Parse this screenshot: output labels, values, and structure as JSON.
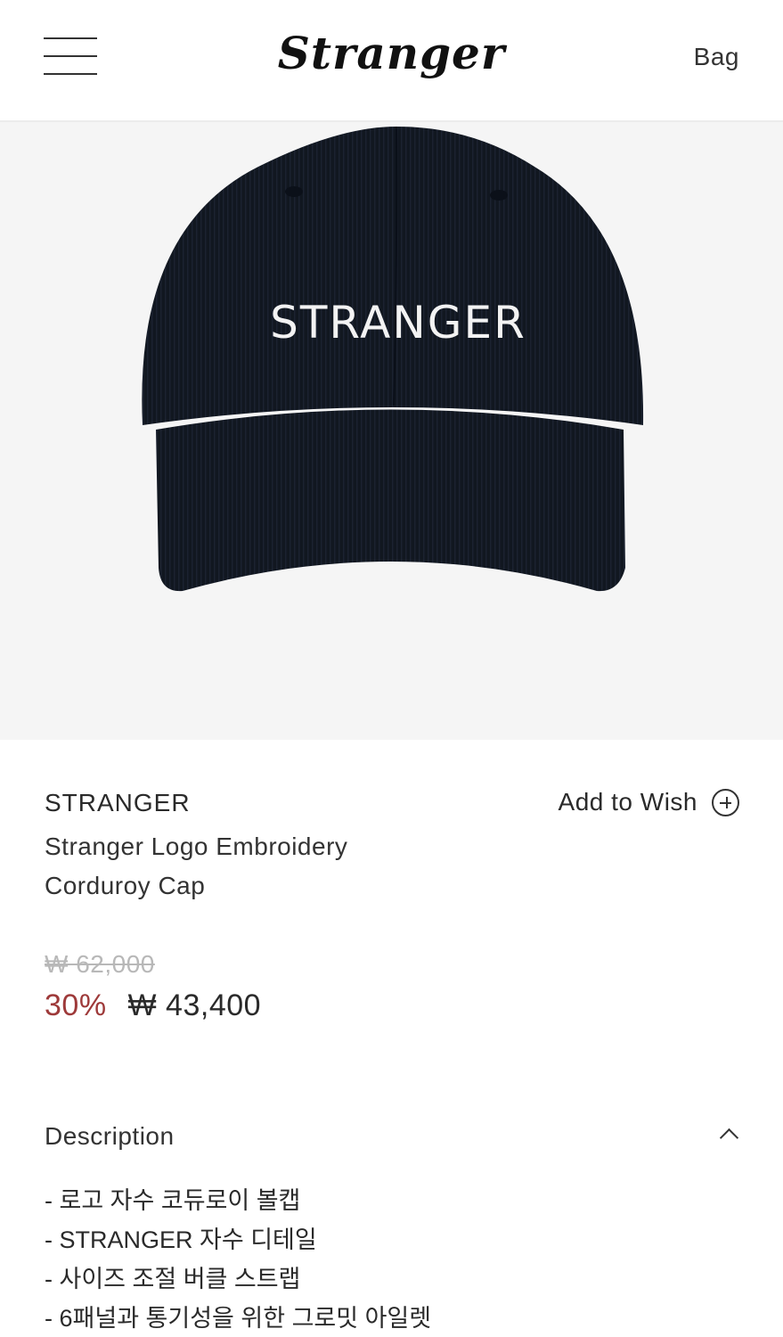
{
  "header": {
    "logo": "Stranger",
    "bag_label": "Bag"
  },
  "product": {
    "image_embroidery_text": "STRANGER",
    "brand": "STRANGER",
    "name": "Stranger Logo Embroidery Corduroy Cap",
    "wish_label": "Add to Wish",
    "price_original": "₩ 62,000",
    "discount": "30%",
    "price_sale": "₩ 43,400"
  },
  "description": {
    "title": "Description",
    "items": [
      "- 로고 자수 코듀로이 볼캡",
      "- STRANGER 자수 디테일",
      "- 사이즈 조절 버클 스트랩",
      "- 6패널과 통기성을 위한 그로밋 아일렛"
    ]
  },
  "colors": {
    "cap": "#111720",
    "discount": "#9e3a3a",
    "image_bg": "#f5f5f5"
  }
}
